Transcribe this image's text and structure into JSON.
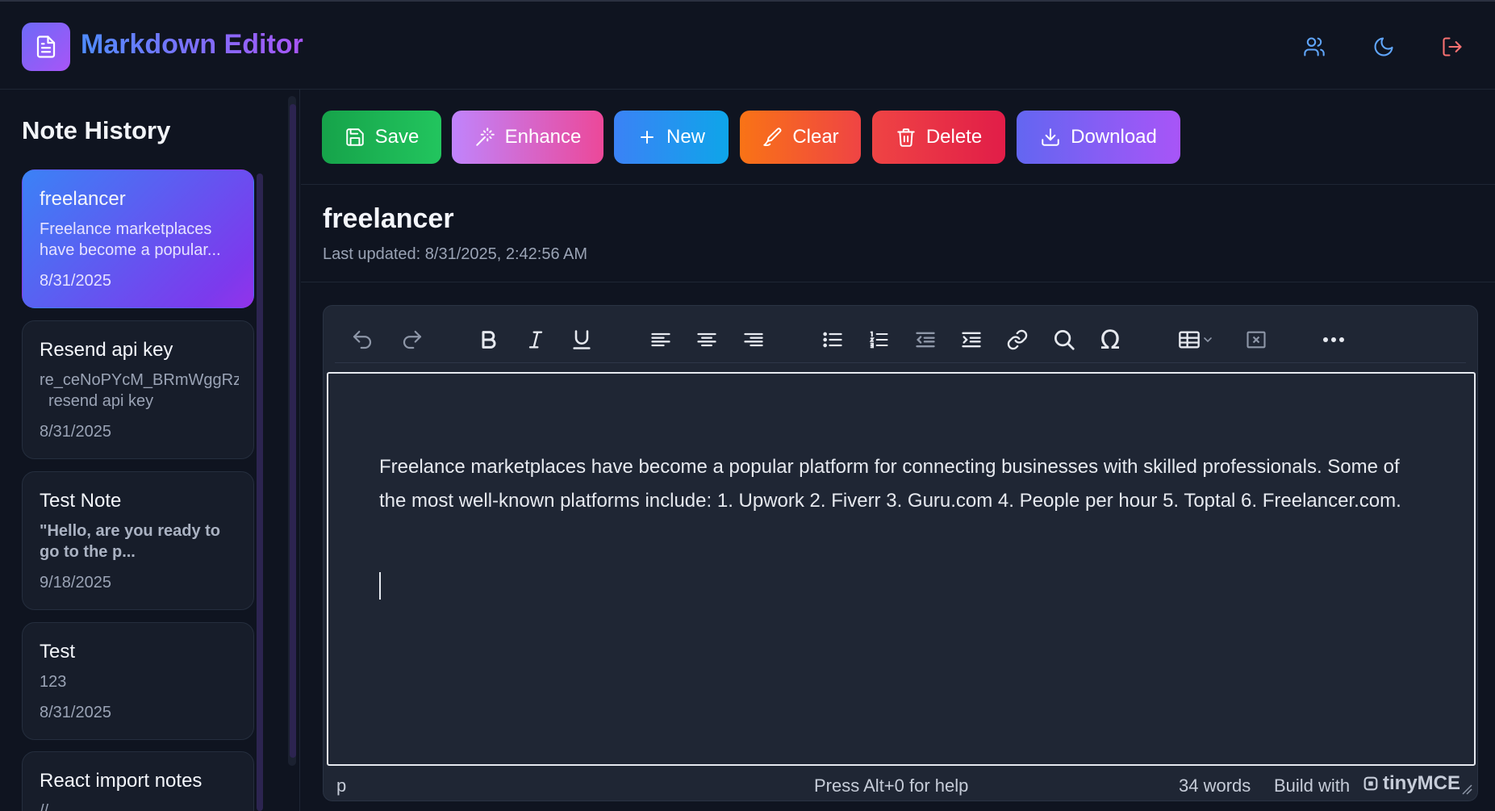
{
  "app": {
    "title": "Markdown Editor"
  },
  "header": {
    "icons": [
      "users-icon",
      "moon-icon",
      "logout-icon"
    ]
  },
  "sidebar": {
    "title": "Note History",
    "notes": [
      {
        "title": "freelancer",
        "snippet": "Freelance marketplaces have become a popular...",
        "date": "8/31/2025",
        "active": true
      },
      {
        "title": "Resend api key",
        "snippet": "re_ceNoPYcM_BRmWggRz resend api key",
        "snippet_line1": "re_ceNoPYcM_BRmWggRz",
        "snippet_line2": "resend api key",
        "date": "8/31/2025",
        "active": false
      },
      {
        "title": "Test Note",
        "snippet": "\"Hello, are you ready to go to the p...",
        "date": "9/18/2025",
        "active": false
      },
      {
        "title": "Test",
        "snippet": "123",
        "date": "8/31/2025",
        "active": false
      },
      {
        "title": "React import notes",
        "snippet": "//",
        "date": "",
        "active": false
      }
    ]
  },
  "actions": {
    "save": "Save",
    "enhance": "Enhance",
    "new": "New",
    "clear": "Clear",
    "delete": "Delete",
    "download": "Download"
  },
  "note": {
    "title": "freelancer",
    "updated": "Last updated: 8/31/2025, 2:42:56 AM",
    "body": "Freelance marketplaces have become a popular platform for connecting businesses with skilled professionals. Some of the most well-known platforms include: 1. Upwork 2. Fiverr 3. Guru.com 4. People per hour 5. Toptal 6. Freelancer.com."
  },
  "editor": {
    "status_element": "p",
    "help": "Press Alt+0 for help",
    "word_count": "34 words",
    "build_with": "Build with",
    "brand": "tinyMCE"
  },
  "colors": {
    "save": "#22c55e",
    "enhance": "#c084fc",
    "new": "#3b82f6",
    "clear": "#f97316",
    "delete": "#ef4444",
    "download": "#6366f1"
  }
}
